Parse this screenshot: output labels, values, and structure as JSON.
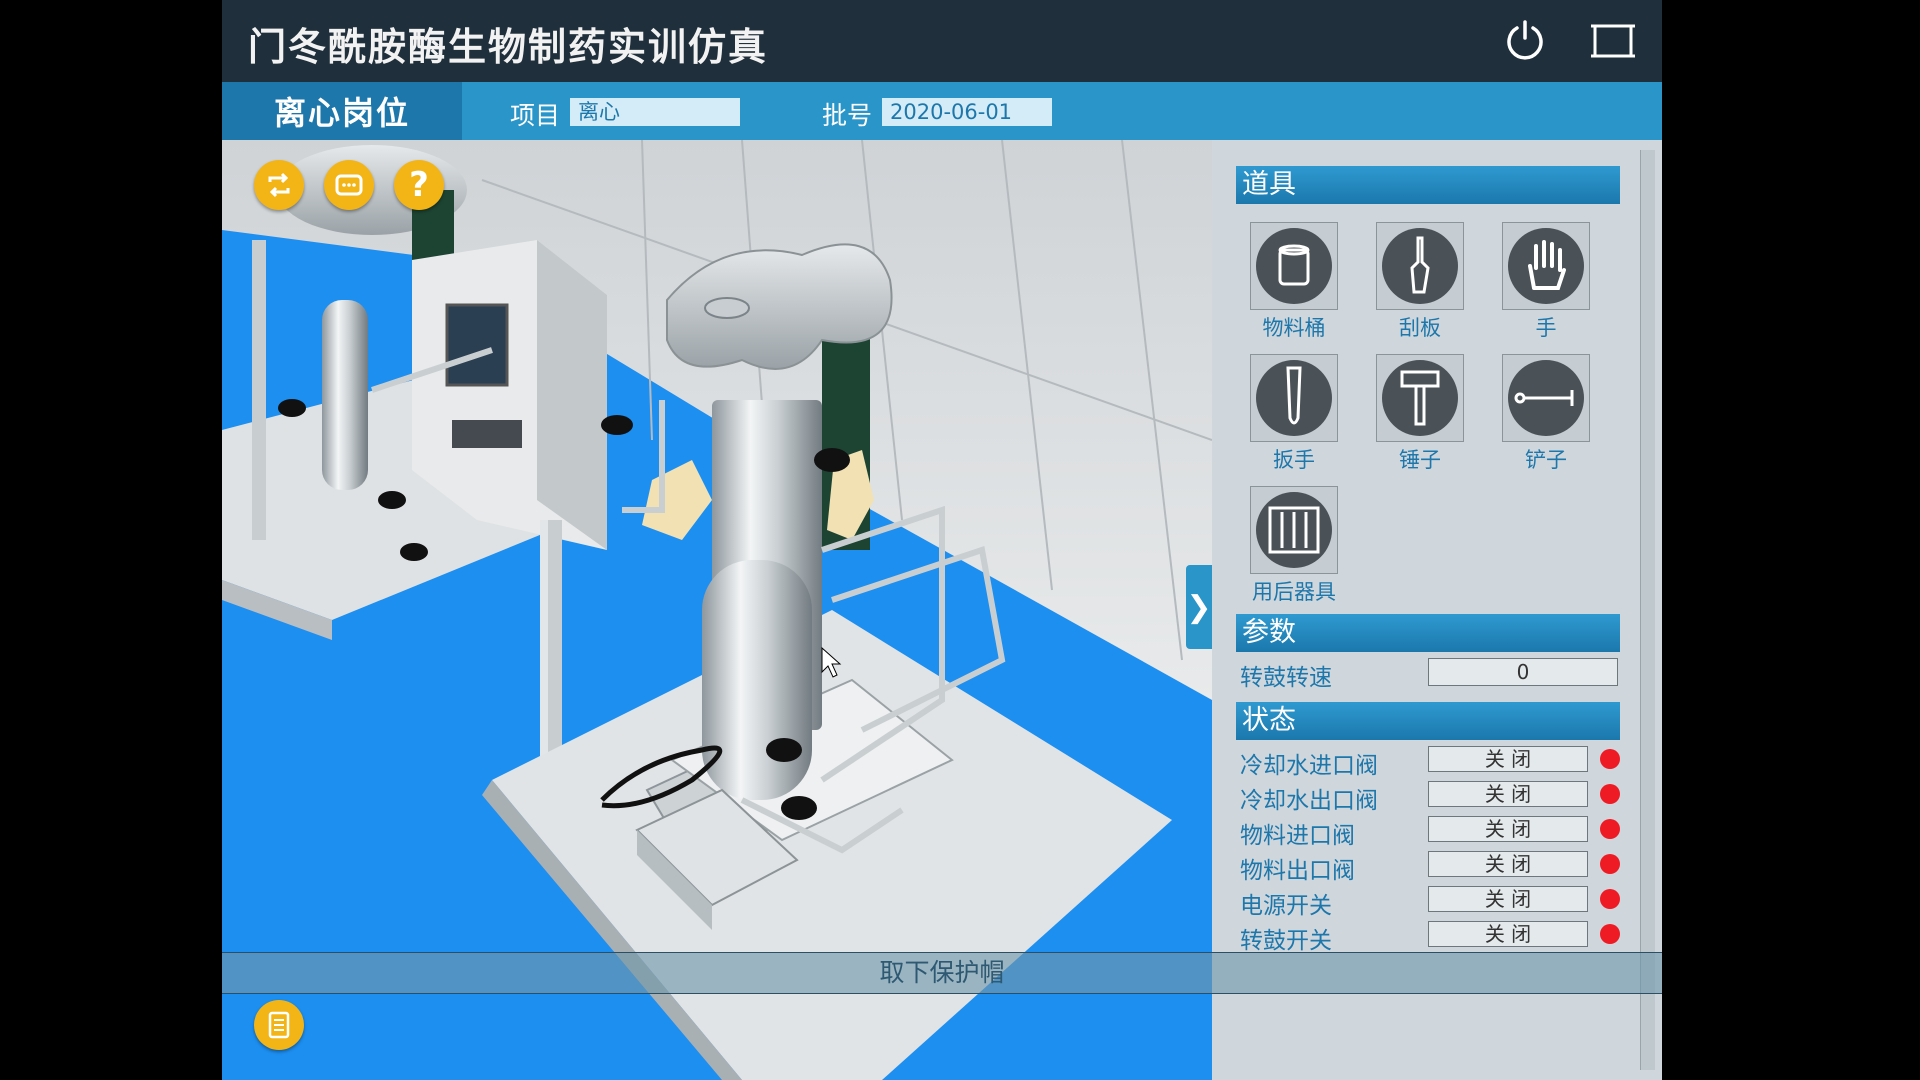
{
  "header": {
    "title": "门冬酰胺酶生物制药实训仿真",
    "power_icon": "power-icon",
    "fullscreen_icon": "fullscreen-icon"
  },
  "info": {
    "station": "离心岗位",
    "project_label": "项目",
    "project_value": "离心",
    "batch_label": "批号",
    "batch_value": "2020-06-01"
  },
  "viewport": {
    "buttons": [
      "reset-icon",
      "chat-icon",
      "help-icon",
      "notes-icon"
    ],
    "help_glyph": "?",
    "collapse_glyph": "❯"
  },
  "panel": {
    "tools_title": "道具",
    "tools": [
      {
        "label": "物料桶",
        "icon": "bucket-icon"
      },
      {
        "label": "刮板",
        "icon": "scraper-icon"
      },
      {
        "label": "手",
        "icon": "hand-icon"
      },
      {
        "label": "扳手",
        "icon": "wrench-icon"
      },
      {
        "label": "锤子",
        "icon": "hammer-icon"
      },
      {
        "label": "铲子",
        "icon": "shovel-icon"
      },
      {
        "label": "用后器具",
        "icon": "used-tools-icon"
      }
    ],
    "params_title": "参数",
    "params": [
      {
        "label": "转鼓转速",
        "value": "0"
      }
    ],
    "status_title": "状态",
    "status": [
      {
        "label": "冷却水进口阀",
        "value": "关 闭",
        "color": "#ef1b24"
      },
      {
        "label": "冷却水出口阀",
        "value": "关 闭",
        "color": "#ef1b24"
      },
      {
        "label": "物料进口阀",
        "value": "关 闭",
        "color": "#ef1b24"
      },
      {
        "label": "物料出口阀",
        "value": "关 闭",
        "color": "#ef1b24"
      },
      {
        "label": "电源开关",
        "value": "关 闭",
        "color": "#ef1b24"
      },
      {
        "label": "转鼓开关",
        "value": "关 闭",
        "color": "#ef1b24"
      }
    ]
  },
  "hint": "取下保护帽",
  "colors": {
    "accent": "#2a95c9",
    "accent_dark": "#1e77ab",
    "floor": "#1d8ff0",
    "button": "#f3b516",
    "status_off": "#ef1b24"
  }
}
